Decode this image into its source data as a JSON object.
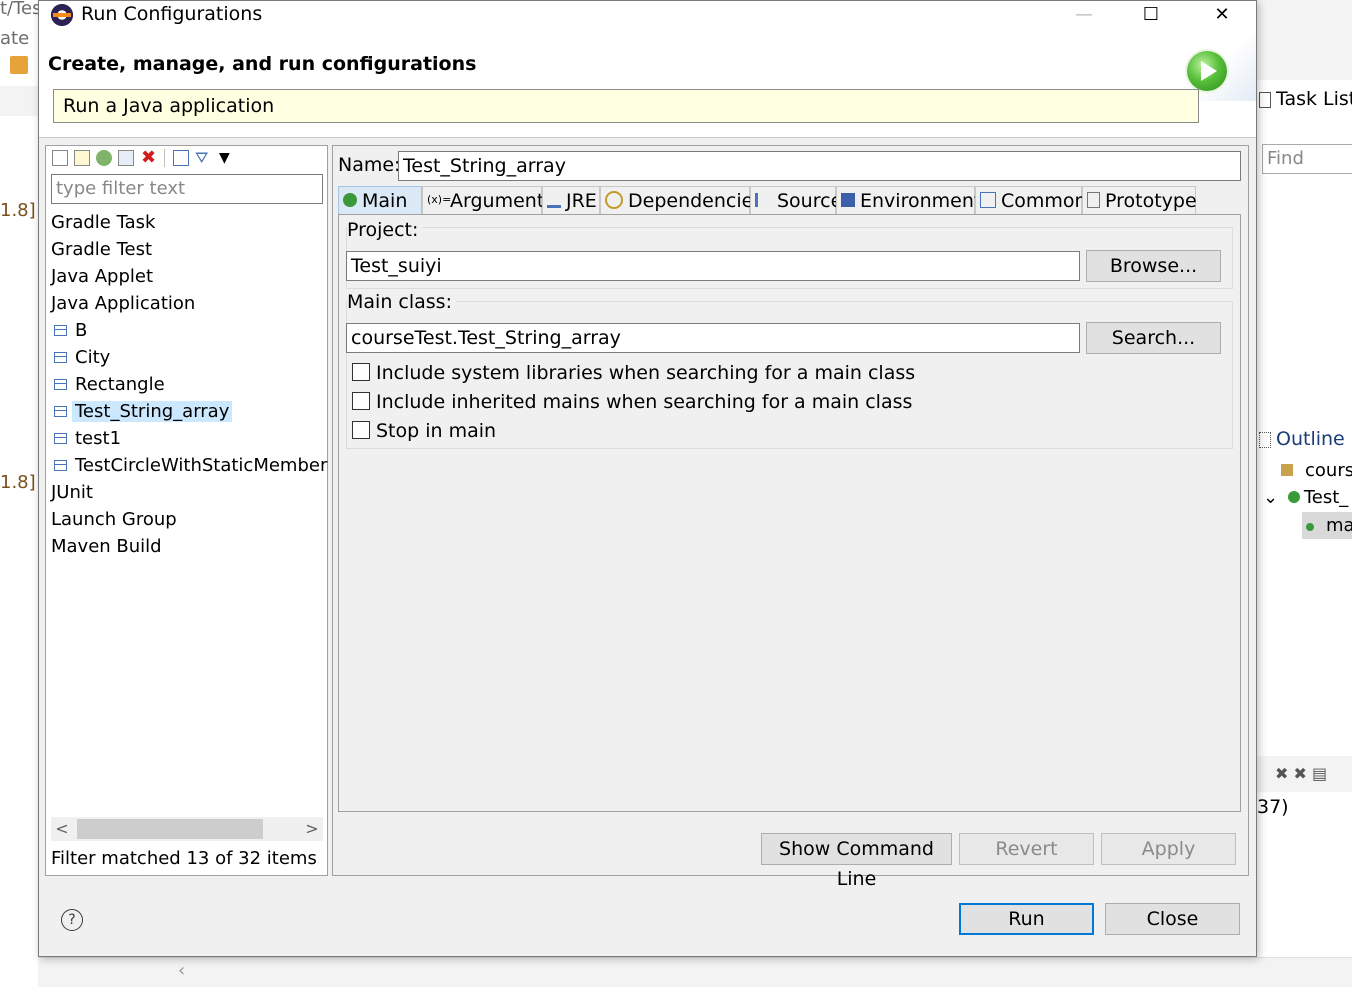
{
  "background": {
    "left_fragments": [
      "t/Tes",
      "ate",
      "1.8]",
      "1.8]"
    ],
    "task_list": {
      "title": "Task List",
      "find_placeholder": "Find"
    },
    "outline": {
      "title": "Outline",
      "items": [
        "cours",
        "Test_",
        "ma"
      ]
    },
    "status_fragment": "37)"
  },
  "dialog": {
    "title": "Run Configurations",
    "window_buttons": {
      "minimize": "—",
      "maximize": "☐",
      "close": "✕"
    },
    "header_title": "Create, manage, and run configurations",
    "message": "Run a Java application"
  },
  "left_pane": {
    "filter_placeholder": "type filter text",
    "tree": [
      {
        "label": "Gradle Task",
        "level": 0,
        "icon": "none"
      },
      {
        "label": "Gradle Test",
        "level": 0,
        "icon": "none"
      },
      {
        "label": "Java Applet",
        "level": 0,
        "icon": "none"
      },
      {
        "label": "Java Application",
        "level": 0,
        "icon": "none"
      },
      {
        "label": "B",
        "level": 1,
        "icon": "java-class-icon"
      },
      {
        "label": "City",
        "level": 1,
        "icon": "java-class-icon"
      },
      {
        "label": "Rectangle",
        "level": 1,
        "icon": "java-class-icon"
      },
      {
        "label": "Test_String_array",
        "level": 1,
        "icon": "java-class-icon",
        "selected": true
      },
      {
        "label": "test1",
        "level": 1,
        "icon": "java-class-icon"
      },
      {
        "label": "TestCircleWithStaticMember",
        "level": 1,
        "icon": "java-class-icon"
      },
      {
        "label": "JUnit",
        "level": 0,
        "icon": "none"
      },
      {
        "label": "Launch Group",
        "level": 0,
        "icon": "none"
      },
      {
        "label": "Maven Build",
        "level": 0,
        "icon": "none"
      }
    ],
    "filter_status": "Filter matched 13 of 32 items"
  },
  "right_pane": {
    "name_label": "Name:",
    "name_value": "Test_String_array",
    "tabs": [
      {
        "label": "Main",
        "icon": "main-tab-icon",
        "active": true
      },
      {
        "label": "Arguments",
        "icon": "arguments-tab-icon"
      },
      {
        "label": "JRE",
        "icon": "jre-tab-icon"
      },
      {
        "label": "Dependencies",
        "icon": "dependencies-tab-icon"
      },
      {
        "label": "Source",
        "icon": "source-tab-icon"
      },
      {
        "label": "Environment",
        "icon": "environment-tab-icon"
      },
      {
        "label": "Common",
        "icon": "common-tab-icon"
      },
      {
        "label": "Prototype",
        "icon": "prototype-tab-icon"
      }
    ],
    "project_label": "Project:",
    "project_value": "Test_suiyi",
    "browse_label": "Browse...",
    "main_class_label": "Main class:",
    "main_class_value": "courseTest.Test_String_array",
    "search_label": "Search...",
    "checkboxes": [
      {
        "label": "Include system libraries when searching for a main class",
        "checked": false
      },
      {
        "label": "Include inherited mains when searching for a main class",
        "checked": false
      },
      {
        "label": "Stop in main",
        "checked": false
      }
    ],
    "show_command_line_label": "Show Command Line",
    "revert_label": "Revert",
    "apply_label": "Apply"
  },
  "footer": {
    "help_label": "?",
    "run_label": "Run",
    "close_label": "Close"
  },
  "colors": {
    "selection": "#cce8ff",
    "message_bg": "#ffffe1",
    "default_button_border": "#0078d7",
    "dialog_bg": "#f0f0f0"
  }
}
